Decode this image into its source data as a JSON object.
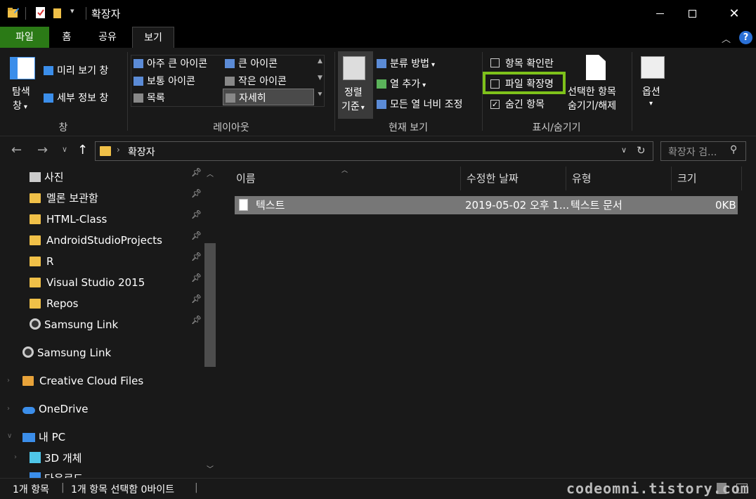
{
  "window": {
    "title": "확장자"
  },
  "tabs": {
    "file": "파일",
    "home": "홈",
    "share": "공유",
    "view": "보기"
  },
  "ribbon": {
    "pane": {
      "nav_pane_1": "탐색",
      "nav_pane_2": "창",
      "preview": "미리 보기 창",
      "details": "세부 정보 창",
      "label": "창"
    },
    "layout": {
      "xl": "아주 큰 아이콘",
      "large": "큰 아이콘",
      "medium": "보통 아이콘",
      "small": "작은 아이콘",
      "list": "목록",
      "details": "자세히",
      "label": "레이아웃"
    },
    "current": {
      "sort1": "정렬",
      "sort2": "기준",
      "group": "분류 방법",
      "add_col": "열 추가",
      "fit_cols": "모든 열 너비 조정",
      "label": "현재 보기"
    },
    "show": {
      "item_cb": "항목 확인란",
      "ext": "파일 확장명",
      "hidden": "숨긴 항목",
      "hide_sel1": "선택한 항목",
      "hide_sel2": "숨기기/해제",
      "label": "표시/숨기기"
    },
    "options": "옵션"
  },
  "address": {
    "path": "확장자",
    "search_placeholder": "확장자 검..."
  },
  "nav": {
    "items": [
      {
        "label": "사진"
      },
      {
        "label": "멜론 보관함"
      },
      {
        "label": "HTML-Class"
      },
      {
        "label": "AndroidStudioProjects"
      },
      {
        "label": "R"
      },
      {
        "label": "Visual Studio 2015"
      },
      {
        "label": "Repos"
      },
      {
        "label": "Samsung Link"
      },
      {
        "label": "Samsung Link"
      },
      {
        "label": "Creative Cloud Files"
      },
      {
        "label": "OneDrive"
      },
      {
        "label": "내 PC"
      },
      {
        "label": "3D 개체"
      },
      {
        "label": "다운로드"
      }
    ]
  },
  "columns": {
    "name": "이름",
    "date": "수정한 날짜",
    "type": "유형",
    "size": "크기"
  },
  "file": {
    "name": "텍스트",
    "date": "2019-05-02 오후 1...",
    "type": "텍스트 문서",
    "size": "0KB"
  },
  "status": {
    "count": "1개 항목",
    "selected": "1개 항목 선택함 0바이트"
  },
  "watermark": "codeomni.tistory.com",
  "colors": {
    "accent": "#2b7a16",
    "highlight": "#7ec11b",
    "selection": "#777777",
    "folder": "#f0c048"
  }
}
